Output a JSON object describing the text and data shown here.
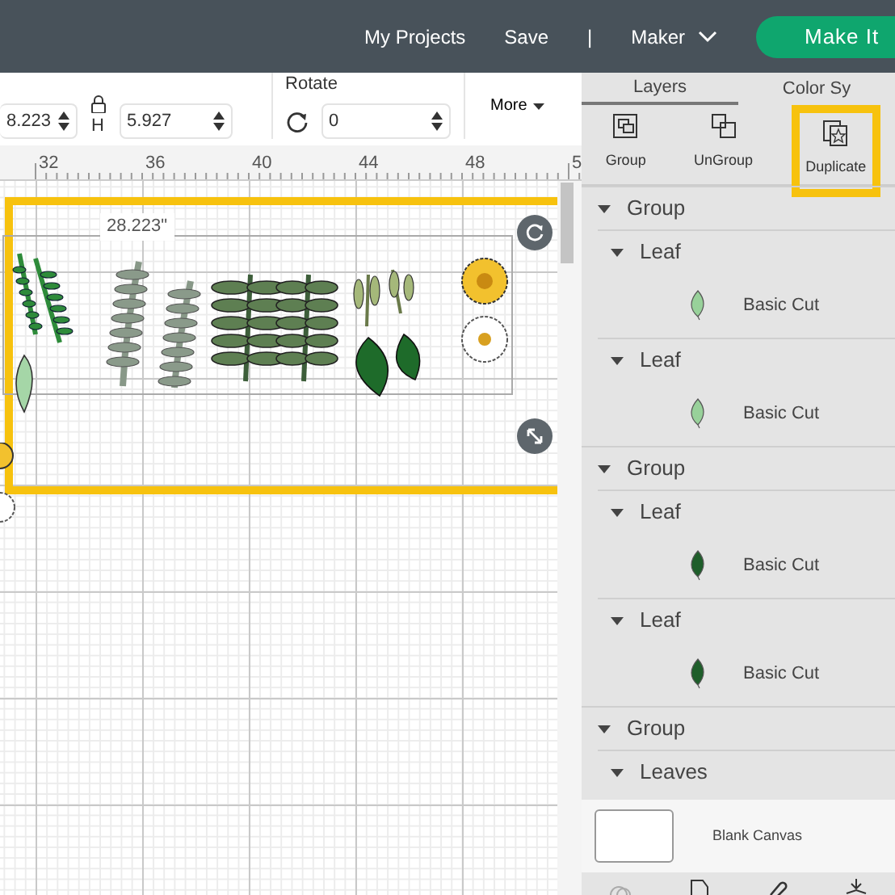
{
  "top_bar": {
    "links": [
      "My Projects",
      "Save",
      "|",
      "Maker"
    ],
    "make_it": "Make It"
  },
  "toolbar": {
    "width_value": "8.223",
    "height_label": "H",
    "height_value": "5.927",
    "rotate_label": "Rotate",
    "rotate_value": "0",
    "more": "More"
  },
  "ruler": {
    "ticks": [
      "32",
      "36",
      "40",
      "44",
      "48",
      "5"
    ]
  },
  "canvas": {
    "dimension_label": "28.223\""
  },
  "panel": {
    "tabs": [
      {
        "label": "Layers",
        "selected": true
      },
      {
        "label": "Color Sy",
        "selected": false
      }
    ],
    "actions": [
      {
        "kind": "group",
        "label": "Group",
        "highlighted": false
      },
      {
        "kind": "ungroup",
        "label": "UnGroup",
        "highlighted": false
      },
      {
        "kind": "duplicate",
        "label": "Duplicate",
        "highlighted": true
      }
    ],
    "layers": [
      {
        "kind": "folder",
        "label": "Group",
        "expanded": true,
        "children": [
          {
            "kind": "folder",
            "label": "Leaf",
            "expanded": true,
            "children": [
              {
                "kind": "cut",
                "label": "Basic Cut",
                "color": "#98d19a"
              }
            ]
          },
          {
            "kind": "folder",
            "label": "Leaf",
            "expanded": true,
            "children": [
              {
                "kind": "cut",
                "label": "Basic Cut",
                "color": "#98d19a"
              }
            ]
          }
        ]
      },
      {
        "kind": "folder",
        "label": "Group",
        "expanded": true,
        "children": [
          {
            "kind": "folder",
            "label": "Leaf",
            "expanded": true,
            "children": [
              {
                "kind": "cut",
                "label": "Basic Cut",
                "color": "#1e5e2a"
              }
            ]
          },
          {
            "kind": "folder",
            "label": "Leaf",
            "expanded": true,
            "children": [
              {
                "kind": "cut",
                "label": "Basic Cut",
                "color": "#1e5e2a"
              }
            ]
          }
        ]
      },
      {
        "kind": "folder",
        "label": "Group",
        "expanded": true,
        "children": [
          {
            "kind": "folder",
            "label": "Leaves",
            "expanded": true
          }
        ]
      }
    ],
    "canvas_item": {
      "label": "Blank Canvas"
    }
  }
}
